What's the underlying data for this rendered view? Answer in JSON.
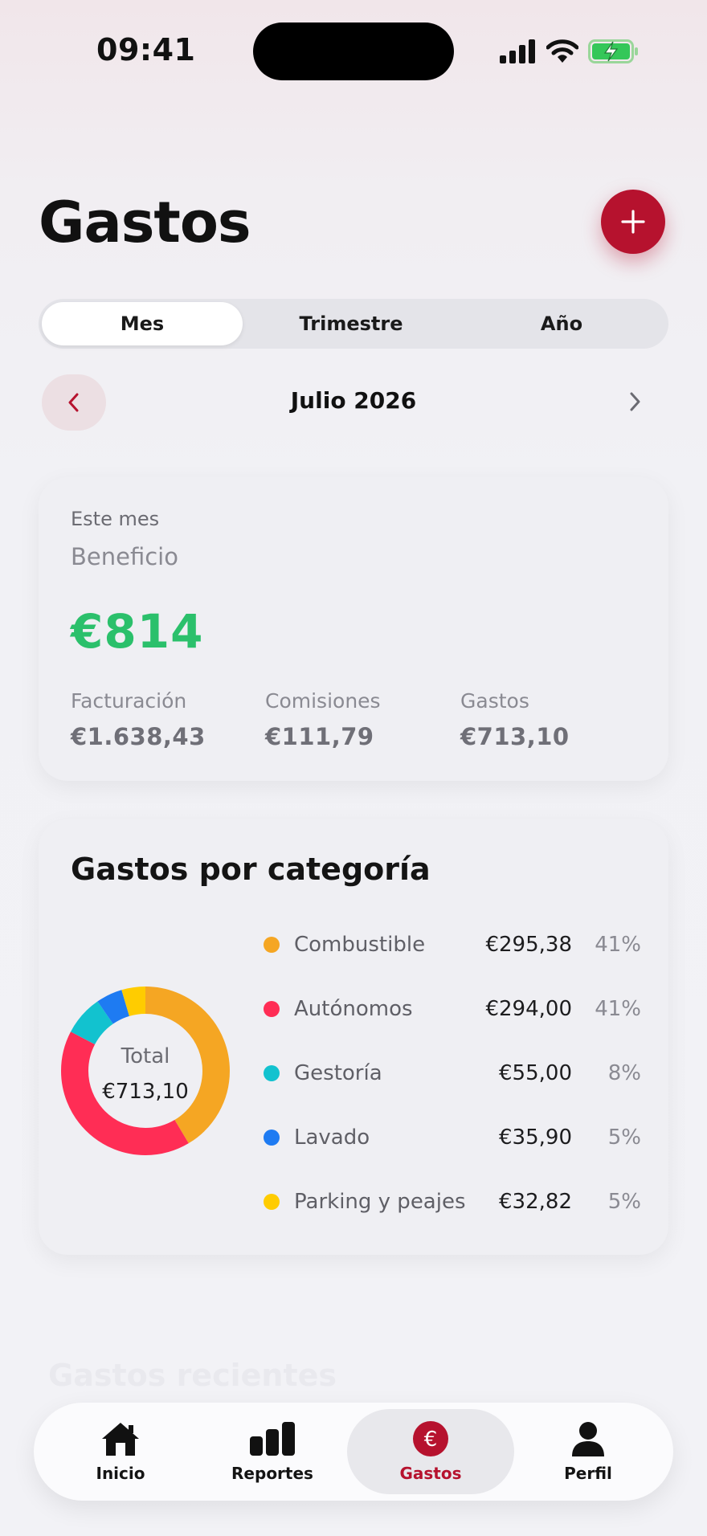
{
  "status_bar": {
    "time": "09:41",
    "icons": [
      "signal-icon",
      "wifi-icon",
      "battery-charging-icon"
    ]
  },
  "header": {
    "title": "Gastos",
    "add_button_icon": "plus-icon"
  },
  "period_tabs": {
    "items": [
      {
        "label": "Mes",
        "active": true
      },
      {
        "label": "Trimestre",
        "active": false
      },
      {
        "label": "Año",
        "active": false
      }
    ]
  },
  "month_nav": {
    "label": "Julio 2026",
    "prev_icon": "chevron-left-icon",
    "next_icon": "chevron-right-icon"
  },
  "summary": {
    "period_label": "Este mes",
    "profit_label": "Beneficio",
    "profit_value": "€814",
    "metrics": [
      {
        "label": "Facturación",
        "value": "€1.638,43"
      },
      {
        "label": "Comisiones",
        "value": "€111,79"
      },
      {
        "label": "Gastos",
        "value": "€713,10"
      }
    ]
  },
  "categories": {
    "title": "Gastos por categoría",
    "total_label": "Total",
    "total_value": "€713,10",
    "items": [
      {
        "name": "Combustible",
        "amount": "€295,38",
        "percent": "41%",
        "color": "#f5a623",
        "value": 295.38
      },
      {
        "name": "Autónomos",
        "amount": "€294,00",
        "percent": "41%",
        "color": "#ff2d55",
        "value": 294.0
      },
      {
        "name": "Gestoría",
        "amount": "€55,00",
        "percent": "8%",
        "color": "#12c2cf",
        "value": 55.0
      },
      {
        "name": "Lavado",
        "amount": "€35,90",
        "percent": "5%",
        "color": "#1e7bf2",
        "value": 35.9
      },
      {
        "name": "Parking y peajes",
        "amount": "€32,82",
        "percent": "5%",
        "color": "#ffcc00",
        "value": 32.82
      }
    ]
  },
  "recent": {
    "title": "Gastos recientes"
  },
  "tabbar": {
    "items": [
      {
        "label": "Inicio",
        "icon": "home-icon",
        "active": false
      },
      {
        "label": "Reportes",
        "icon": "bar-chart-icon",
        "active": false
      },
      {
        "label": "Gastos",
        "icon": "euro-icon",
        "active": true
      },
      {
        "label": "Perfil",
        "icon": "person-icon",
        "active": false
      }
    ]
  },
  "colors": {
    "brand": "#b6122e",
    "profit": "#2bc06b"
  }
}
